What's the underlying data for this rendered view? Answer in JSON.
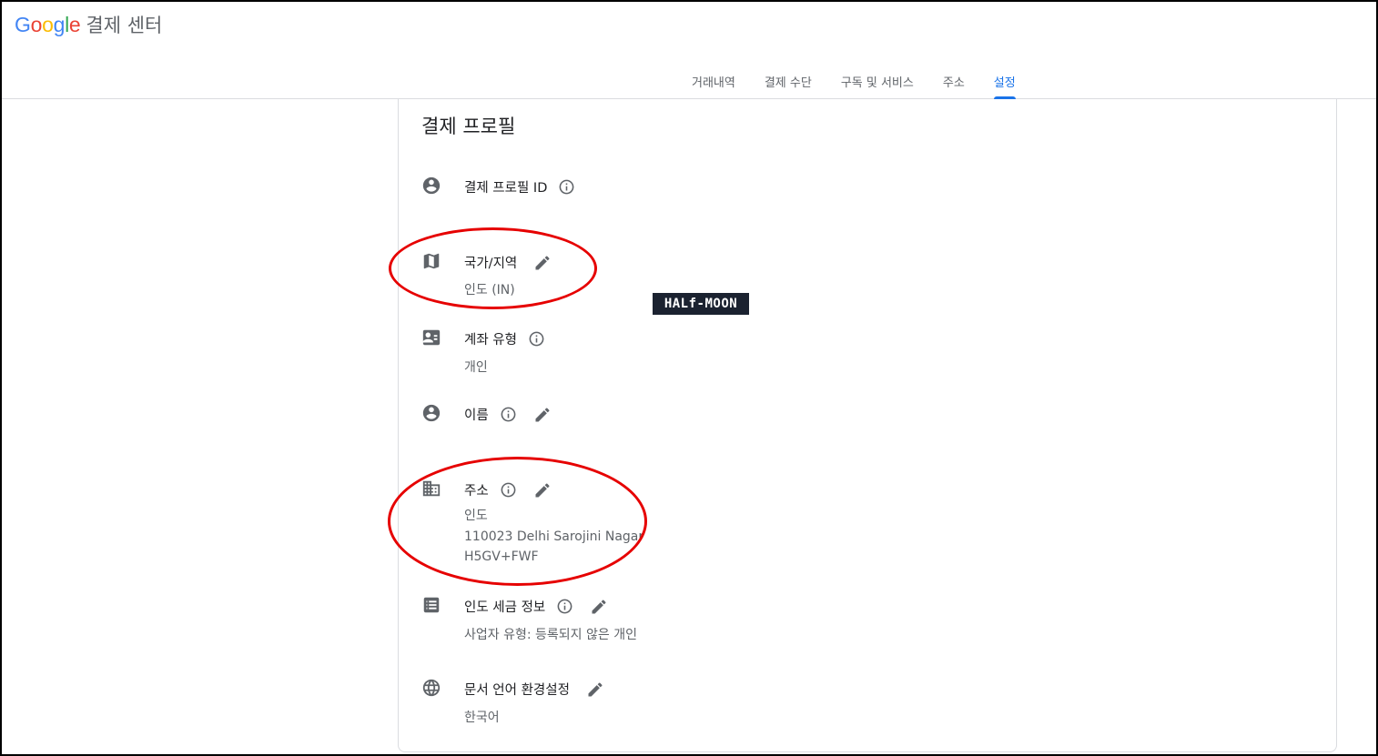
{
  "app": {
    "logo": "Google",
    "title": "결제 센터"
  },
  "nav": {
    "tabs": [
      "거래내역",
      "결제 수단",
      "구독 및 서비스",
      "주소",
      "설정"
    ],
    "active_index": 4
  },
  "colors": {
    "accent": "#1a73e8",
    "highlight_circle": "#e60000",
    "muted": "#5f6368"
  },
  "profile": {
    "title": "결제 프로필",
    "id_row": {
      "label": "결제 프로필 ID",
      "icon": "account-circle-icon"
    },
    "country_row": {
      "label": "국가/지역",
      "value": "인도 (IN)",
      "icon": "map-icon"
    },
    "account_type_row": {
      "label": "계좌 유형",
      "value": "개인",
      "icon": "contact-card-icon"
    },
    "name_row": {
      "label": "이름",
      "icon": "account-circle-icon"
    },
    "address_row": {
      "label": "주소",
      "line1": "인도",
      "line2": "110023 Delhi Sarojini Nagar",
      "line3": "H5GV+FWF",
      "icon": "building-icon"
    },
    "tax_row": {
      "label": "인도 세금 정보",
      "value": "사업자 유형: 등록되지 않은 개인",
      "icon": "list-icon"
    },
    "language_row": {
      "label": "문서 언어 환경설정",
      "value": "한국어",
      "icon": "globe-icon"
    }
  },
  "watermark": {
    "text": "HALf-MOON"
  }
}
